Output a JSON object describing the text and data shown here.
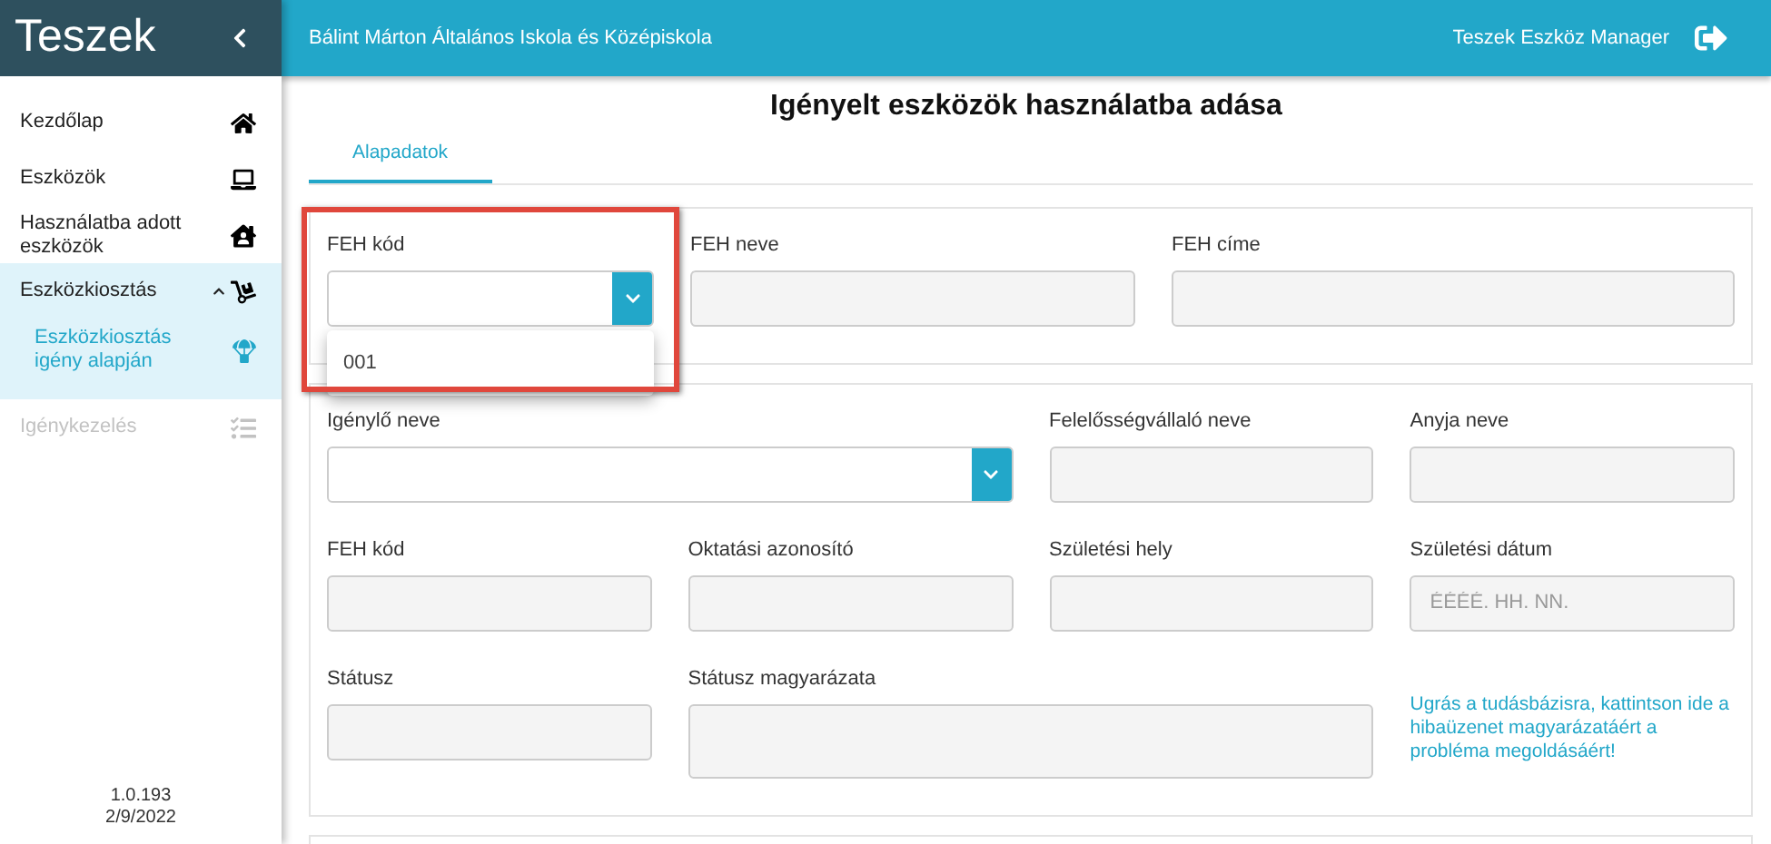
{
  "sidebar": {
    "title": "Teszek",
    "items": [
      {
        "label": "Kezdőlap",
        "expanded": false,
        "disabled": false
      },
      {
        "label": "Eszközök",
        "expanded": false,
        "disabled": false
      },
      {
        "label": "Használatba adott eszközök",
        "expanded": false,
        "disabled": false
      },
      {
        "label": "Eszközkiosztás",
        "expanded": true,
        "disabled": false,
        "children": [
          {
            "label": "Eszközkiosztás igény alapján",
            "selected": true
          }
        ]
      },
      {
        "label": "Igénykezelés",
        "expanded": false,
        "disabled": true
      }
    ],
    "version": "1.0.193",
    "date": "2/9/2022"
  },
  "header": {
    "school": "Bálint Márton Általános Iskola és Középiskola",
    "app_name": "Teszek Eszköz Manager"
  },
  "page_title": "Igényelt eszközök használatba adása",
  "tabs": [
    {
      "label": "Alapadatok",
      "selected": true
    }
  ],
  "sections": [
    {
      "fields": [
        {
          "label": "FEH kód",
          "kind": "select",
          "open": true,
          "options": [
            "001"
          ]
        },
        {
          "label": "FEH neve",
          "kind": "text"
        },
        {
          "label": "FEH címe",
          "kind": "text"
        }
      ]
    },
    {
      "fields": [
        {
          "label": "Igénylő neve",
          "kind": "select",
          "open": false
        },
        {
          "label": "Felelősségvállaló neve",
          "kind": "text"
        },
        {
          "label": "Anyja neve",
          "kind": "text"
        },
        {
          "label": "FEH kód",
          "kind": "text"
        },
        {
          "label": "Oktatási azonosító",
          "kind": "text"
        },
        {
          "label": "Születési hely",
          "kind": "text"
        },
        {
          "label": "Születési dátum",
          "kind": "text",
          "placeholder": "ÉÉÉÉ. HH. NN."
        },
        {
          "label": "Státusz",
          "kind": "text"
        },
        {
          "label": "Státusz magyarázata",
          "kind": "textarea"
        },
        {
          "label": "Ugrás a tudásbázisra, kattintson ide a hibaüzenet magyarázatáért a probléma megoldásáért!",
          "kind": "link"
        }
      ]
    }
  ]
}
